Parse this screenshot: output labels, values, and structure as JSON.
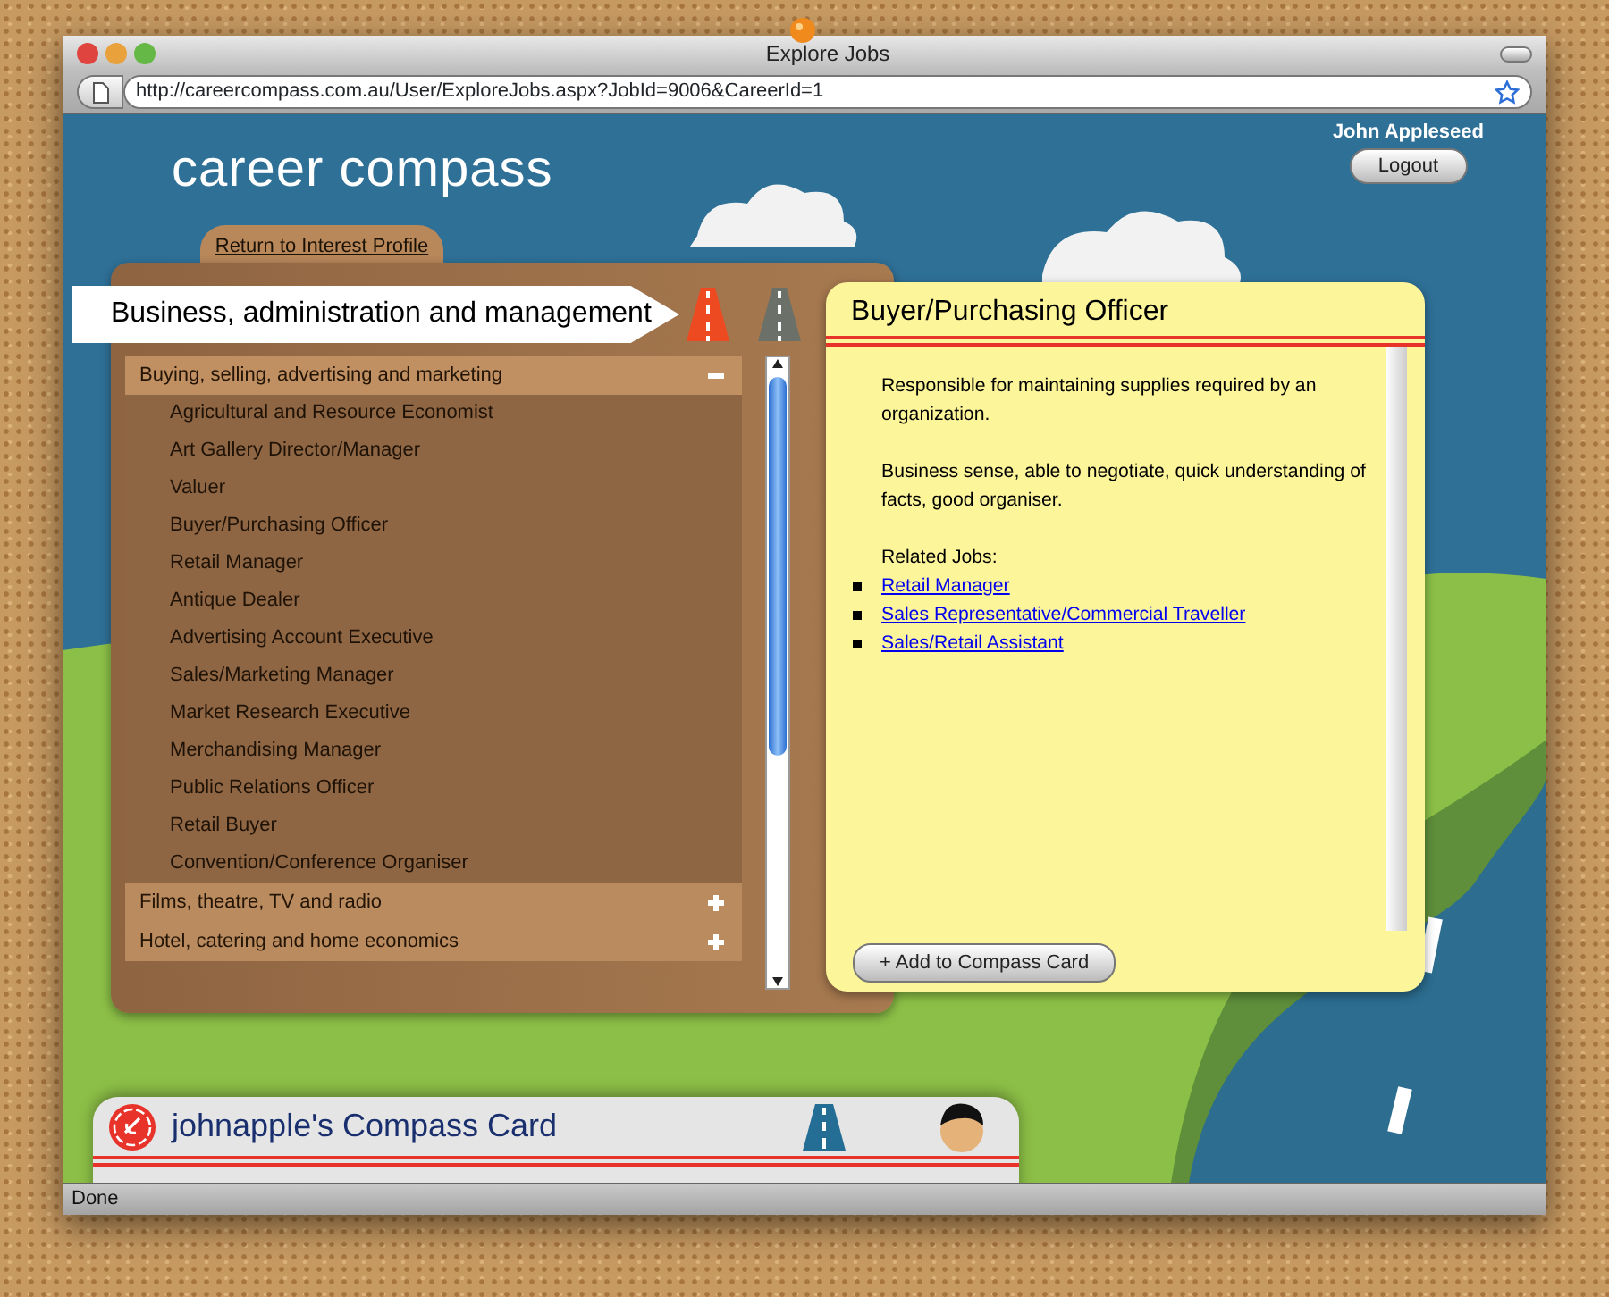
{
  "window": {
    "title": "Explore Jobs"
  },
  "address_bar": {
    "url": "http://careercompass.com.au/User/ExploreJobs.aspx?JobId=9006&CareerId=1"
  },
  "header": {
    "logo": "career compass",
    "user_name": "John Appleseed",
    "logout_button": "Logout"
  },
  "back_tab": {
    "label": "Return to Interest Profile"
  },
  "category_banner": {
    "title": "Business, administration and management"
  },
  "road_icons": [
    {
      "selected": true
    },
    {
      "selected": false
    }
  ],
  "job_groups": [
    {
      "label": "Buying, selling, advertising and marketing",
      "expanded": true,
      "jobs": [
        "Agricultural and Resource Economist",
        "Art Gallery Director/Manager",
        "Valuer",
        "Buyer/Purchasing Officer",
        "Retail Manager",
        "Antique Dealer",
        "Advertising Account Executive",
        "Sales/Marketing Manager",
        "Market Research Executive",
        "Merchandising Manager",
        "Public Relations Officer",
        "Retail Buyer",
        "Convention/Conference Organiser"
      ]
    },
    {
      "label": "Films, theatre, TV and radio",
      "expanded": false
    },
    {
      "label": "Hotel, catering and home economics",
      "expanded": false
    }
  ],
  "job_detail": {
    "title": "Buyer/Purchasing Officer",
    "paragraphs": [
      "Responsible for maintaining supplies required by an organization.",
      "Business sense, able to negotiate, quick understanding of facts, good organiser."
    ],
    "related_heading": "Related Jobs:",
    "related_jobs": [
      "Retail Manager",
      "Sales Representative/Commercial Traveller",
      "Sales/Retail Assistant"
    ],
    "add_button": "+ Add to Compass Card"
  },
  "compass_card": {
    "title": "johnapple's Compass Card"
  },
  "status_bar": {
    "text": "Done"
  }
}
